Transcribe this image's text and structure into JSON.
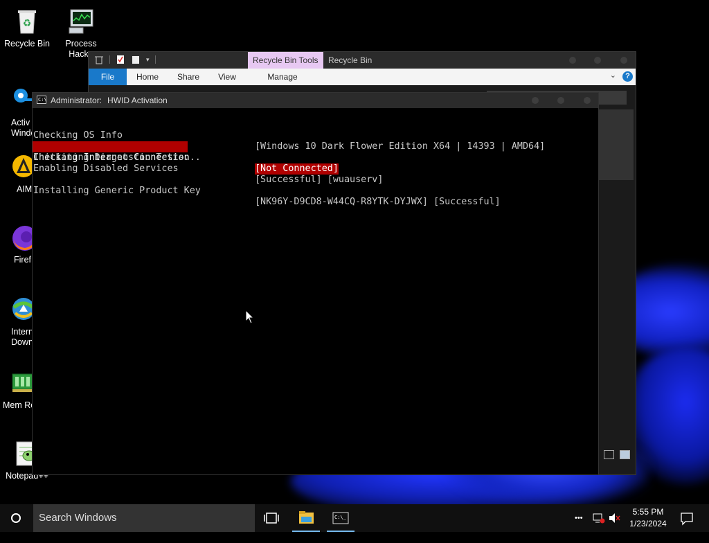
{
  "desktop": {
    "icons": [
      {
        "label": "Recycle Bin"
      },
      {
        "label": "Process Hacker"
      },
      {
        "label": "Activate Windows"
      },
      {
        "label": "AIMP"
      },
      {
        "label": "Firefox"
      },
      {
        "label": "Internet Download"
      },
      {
        "label": "Mem Reduct"
      },
      {
        "label": "Notepad++"
      }
    ],
    "icons_visible_text": [
      "Recycle Bin",
      "Process\nHacke",
      "Activ\nWindo",
      "AIM",
      "Firef",
      "Intern\nDown",
      "Mem Re",
      "Notepad++"
    ]
  },
  "explorer": {
    "tool_tab": "Recycle Bin Tools",
    "title": "Recycle Bin",
    "tabs": {
      "file": "File",
      "home": "Home",
      "share": "Share",
      "view": "View",
      "manage": "Manage"
    },
    "help": "?"
  },
  "console": {
    "title_prefix": "Administrator:",
    "title": "HWID Activation",
    "lines": [
      {
        "label": "Checking OS Info",
        "value": "[Windows 10 Dark Flower Edition X64 | 14393 | AMD64]",
        "highlight": false
      },
      {
        "label": "Checking Internet Connection",
        "value": "[Not Connected]",
        "highlight": true
      },
      {
        "label": "Initiating Diagnostic Tests...",
        "value": "",
        "highlight": false
      },
      {
        "label": "Enabling Disabled Services",
        "value": "[Successful] [wuauserv]",
        "highlight": false
      },
      {
        "label": "",
        "value": "",
        "highlight": false
      },
      {
        "label": "Installing Generic Product Key",
        "value": "[NK96Y-D9CD8-W44CQ-R8YTK-DYJWX] [Successful]",
        "highlight": false
      }
    ]
  },
  "taskbar": {
    "search_placeholder": "Search Windows",
    "time": "5:55 PM",
    "date": "1/23/2024",
    "overflow": "•••"
  },
  "colors": {
    "highlight_red": "#b00000",
    "file_tab_blue": "#1979ca",
    "tool_tab_purple": "#e7c8f2",
    "taskbar_bg": "#101010"
  },
  "icon_names": [
    "recycle-bin-icon",
    "process-hacker-icon",
    "activate-icon",
    "aimp-icon",
    "firefox-icon",
    "idm-icon",
    "mem-reduct-icon",
    "notepadpp-icon",
    "task-view-icon",
    "file-explorer-icon",
    "cmd-icon",
    "network-icon",
    "volume-muted-icon",
    "action-center-icon"
  ]
}
